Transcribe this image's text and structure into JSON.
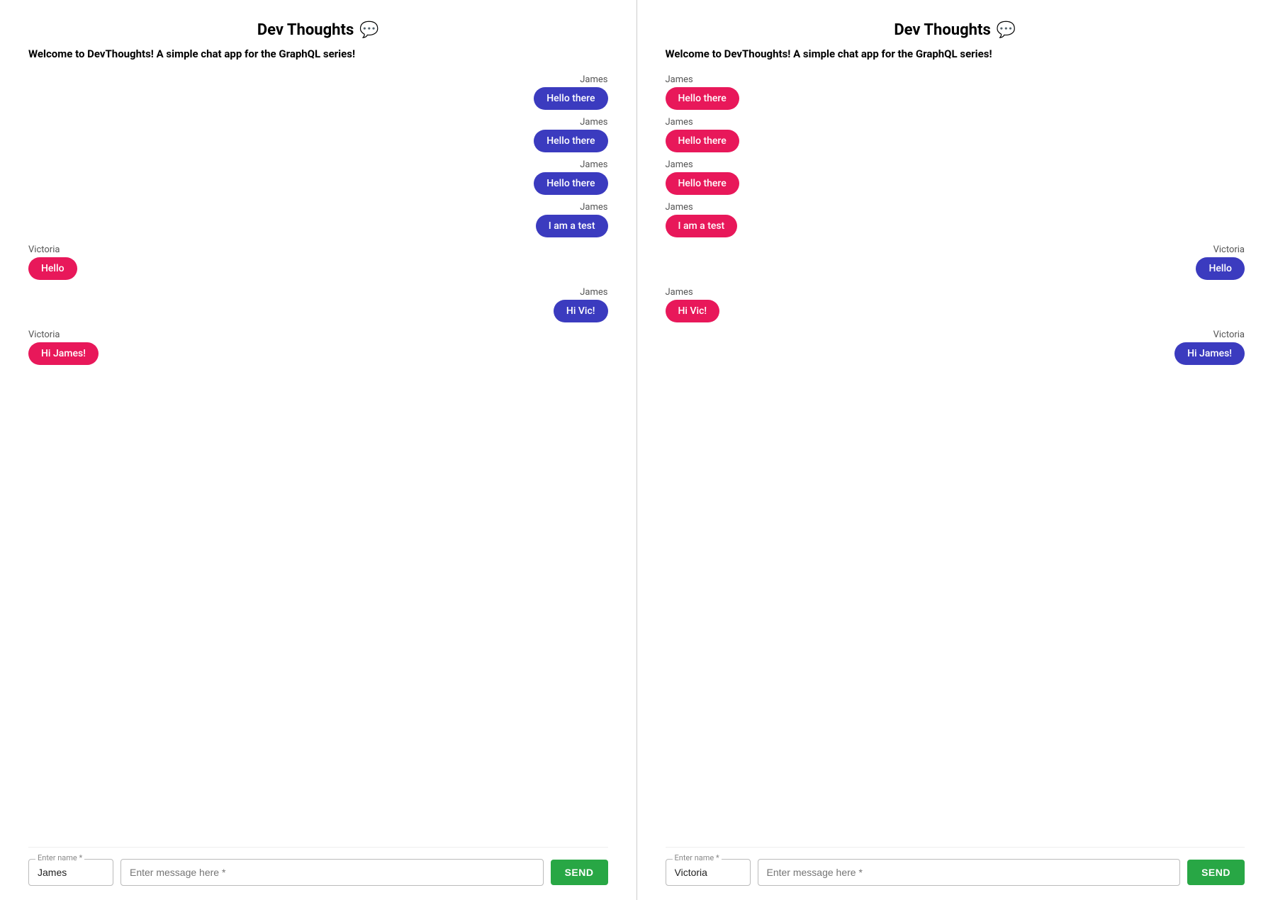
{
  "panels": [
    {
      "id": "panel-left",
      "title": "Dev Thoughts",
      "title_icon": "💬",
      "welcome": "Welcome to DevThoughts! A simple chat app for the GraphQL series!",
      "messages": [
        {
          "sender": "James",
          "text": "Hello there",
          "side": "right",
          "color": "blue"
        },
        {
          "sender": "James",
          "text": "Hello there",
          "side": "right",
          "color": "blue"
        },
        {
          "sender": "James",
          "text": "Hello there",
          "side": "right",
          "color": "blue"
        },
        {
          "sender": "James",
          "text": "I am a test",
          "side": "right",
          "color": "blue"
        },
        {
          "sender": "Victoria",
          "text": "Hello",
          "side": "left",
          "color": "pink"
        },
        {
          "sender": "James",
          "text": "Hi Vic!",
          "side": "right",
          "color": "blue"
        },
        {
          "sender": "Victoria",
          "text": "Hi James!",
          "side": "left",
          "color": "pink"
        }
      ],
      "name_label": "Enter name *",
      "name_value": "James",
      "message_placeholder": "Enter message here *",
      "send_label": "SEND"
    },
    {
      "id": "panel-right",
      "title": "Dev Thoughts",
      "title_icon": "💬",
      "welcome": "Welcome to DevThoughts! A simple chat app for the GraphQL series!",
      "messages": [
        {
          "sender": "James",
          "text": "Hello there",
          "side": "left",
          "color": "pink"
        },
        {
          "sender": "James",
          "text": "Hello there",
          "side": "left",
          "color": "pink"
        },
        {
          "sender": "James",
          "text": "Hello there",
          "side": "left",
          "color": "pink"
        },
        {
          "sender": "James",
          "text": "I am a test",
          "side": "left",
          "color": "pink"
        },
        {
          "sender": "Victoria",
          "text": "Hello",
          "side": "right",
          "color": "blue"
        },
        {
          "sender": "James",
          "text": "Hi Vic!",
          "side": "left",
          "color": "pink"
        },
        {
          "sender": "Victoria",
          "text": "Hi James!",
          "side": "right",
          "color": "blue"
        }
      ],
      "name_label": "Enter name *",
      "name_value": "Victoria",
      "message_placeholder": "Enter message here *",
      "send_label": "SEND"
    }
  ]
}
